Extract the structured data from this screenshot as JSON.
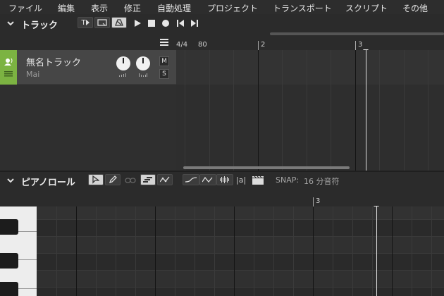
{
  "menu": [
    "ファイル",
    "編集",
    "表示",
    "修正",
    "自動処理",
    "プロジェクト",
    "トランスポート",
    "スクリプト",
    "その他"
  ],
  "tracks_panel": {
    "title": "トラック",
    "tool_text_label": "T",
    "ruler": {
      "time_signature": "4/4",
      "tempo": "80",
      "bar_2": "2",
      "bar_3": "3"
    },
    "track": {
      "name": "無名トラック",
      "subtitle": "Mai",
      "color": "#7cb342",
      "mute_label": "M",
      "solo_label": "S"
    }
  },
  "piano_roll": {
    "title": "ピアノロール",
    "lyric_label": "|a|",
    "snap_label": "SNAP:",
    "snap_value": "16 分音符",
    "ruler": {
      "bar_3": "3"
    }
  },
  "colors": {
    "accent": "#7cb342",
    "bg": "#2b2b2b",
    "playhead": "#e0e0e0"
  }
}
